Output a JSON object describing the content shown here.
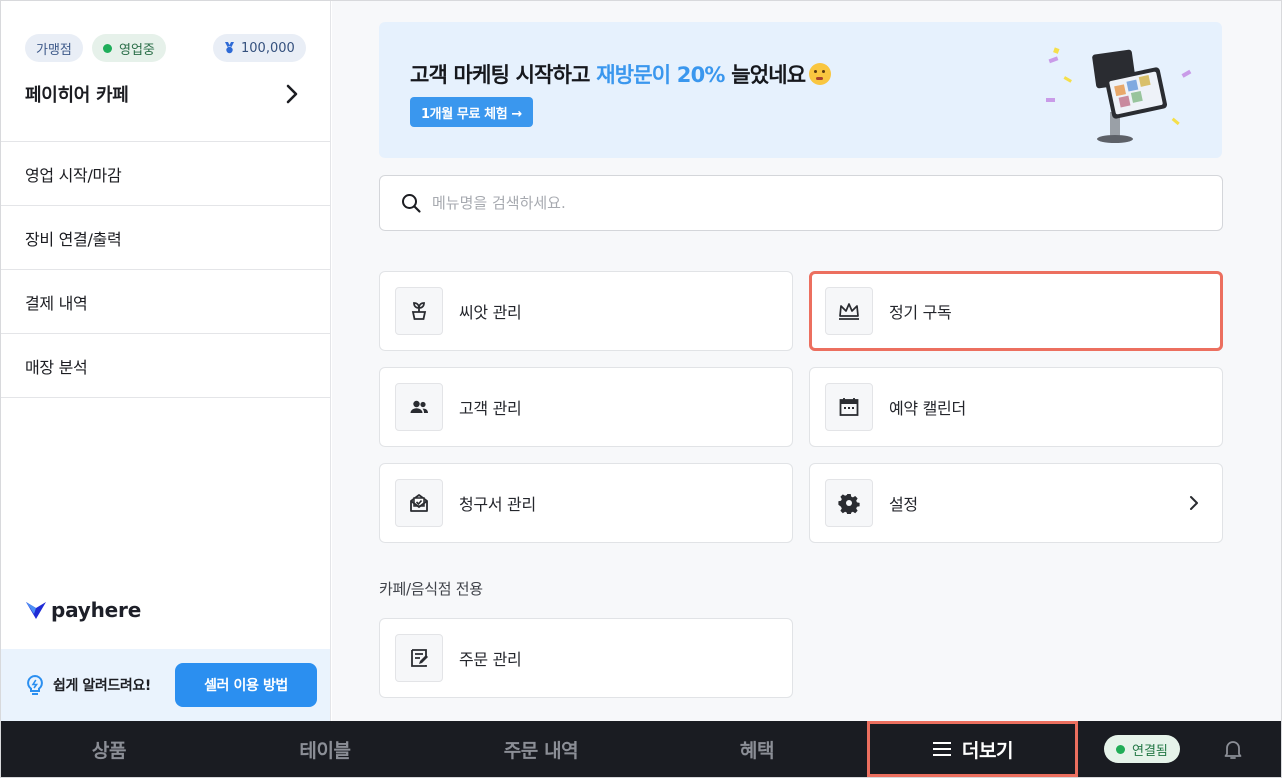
{
  "sidebar": {
    "chips": {
      "franchise": "가맹점",
      "status": "영업중",
      "points": "100,000"
    },
    "store_name": "페이히어 카페",
    "items": [
      {
        "label": "영업 시작/마감"
      },
      {
        "label": "장비 연결/출력"
      },
      {
        "label": "결제 내역"
      },
      {
        "label": "매장 분석"
      }
    ],
    "logo_text": "payhere",
    "help": {
      "text": "쉽게 알려드려요!",
      "button": "셀러 이용 방법"
    }
  },
  "banner": {
    "title_prefix": "고객 마케팅 시작하고 ",
    "title_highlight": "재방문이 20%",
    "title_suffix": " 늘었네요",
    "cta": "1개월 무료 체험 →"
  },
  "search": {
    "placeholder": "메뉴명을 검색하세요."
  },
  "menu": {
    "seed": "씨앗 관리",
    "subscription": "정기 구독",
    "customers": "고객 관리",
    "reservation": "예약 캘린더",
    "invoice": "청구서 관리",
    "settings": "설정",
    "section_cafe": "카페/음식점 전용",
    "orders": "주문 관리"
  },
  "bottom_nav": {
    "products": "상품",
    "tables": "테이블",
    "order_history": "주문 내역",
    "benefits": "혜택",
    "more": "더보기",
    "connection": "연결됨"
  },
  "colors": {
    "accent": "#2b8ff0",
    "highlight_outline": "#ec6f5f",
    "nav_bg": "#1a1c22",
    "status_green": "#1fae5a"
  }
}
